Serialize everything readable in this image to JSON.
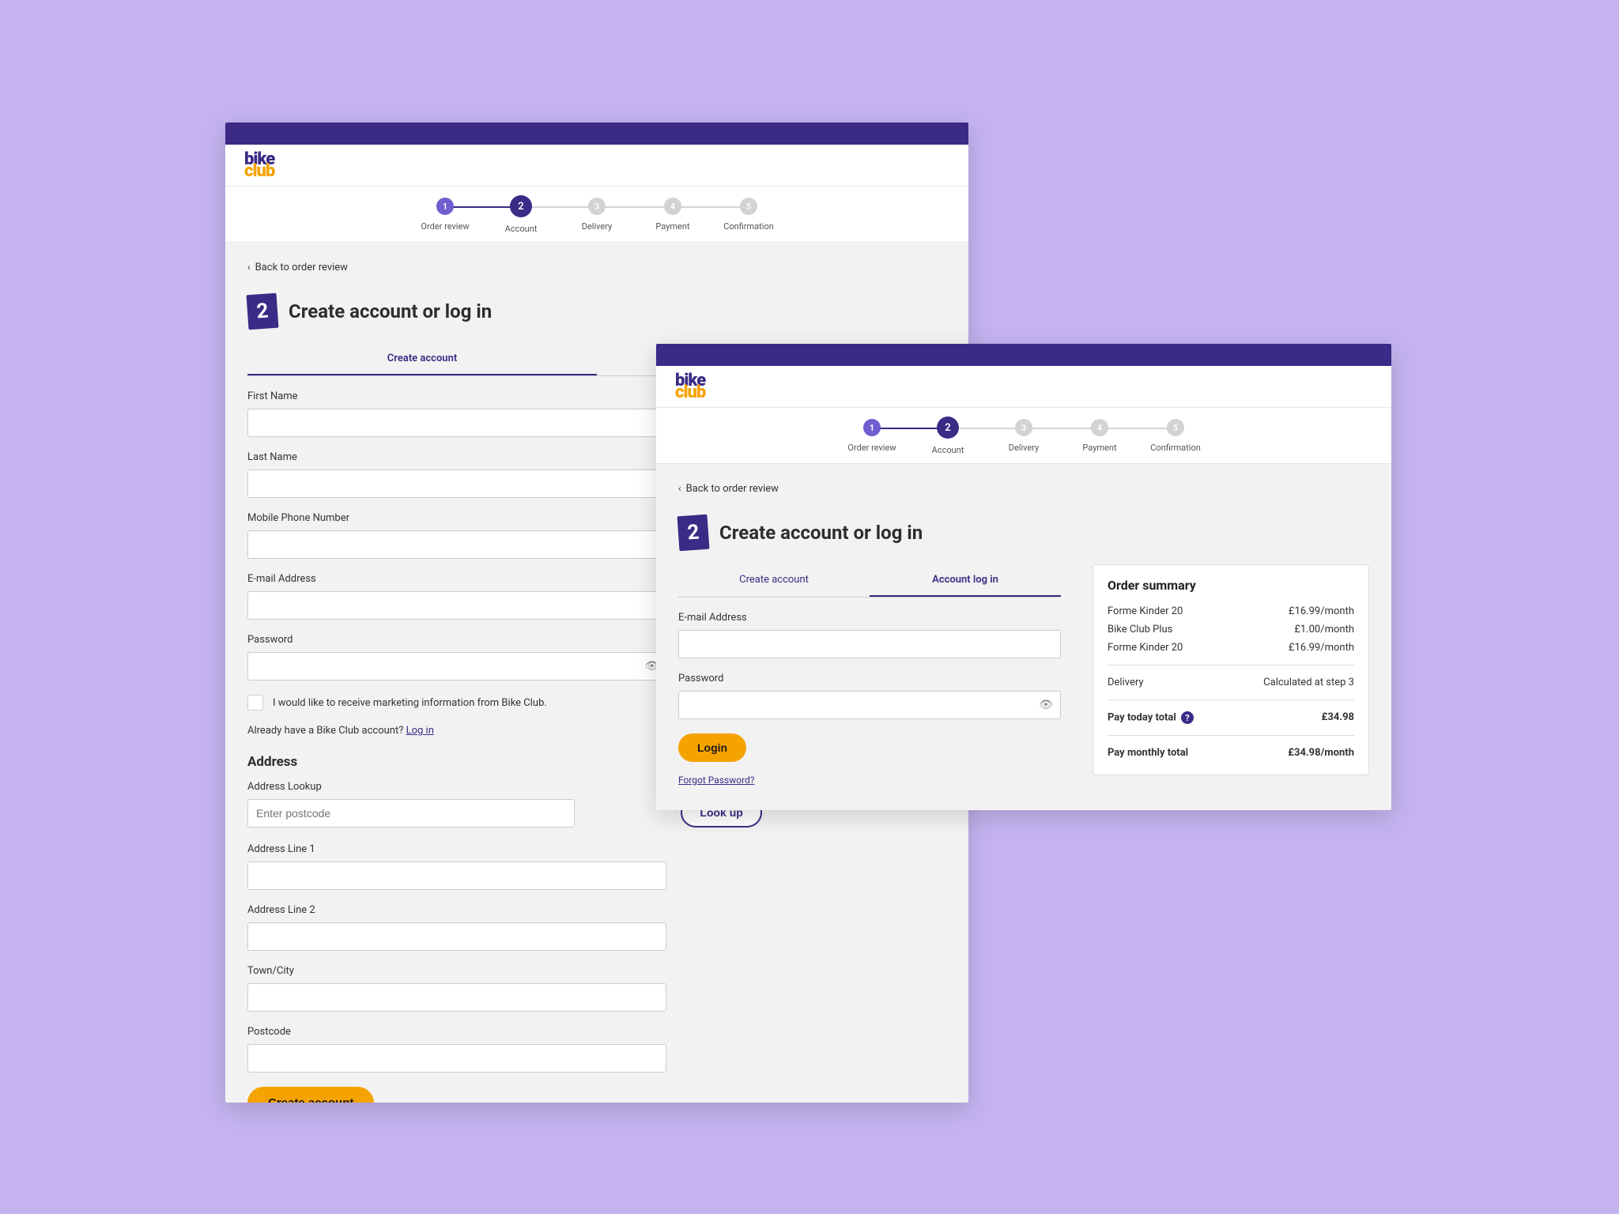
{
  "brand": {
    "line1": "bike",
    "line2": "club"
  },
  "stepper": {
    "steps": [
      {
        "num": "1",
        "label": "Order review"
      },
      {
        "num": "2",
        "label": "Account"
      },
      {
        "num": "3",
        "label": "Delivery"
      },
      {
        "num": "4",
        "label": "Payment"
      },
      {
        "num": "5",
        "label": "Confirmation"
      }
    ]
  },
  "backLink": "Back to order review",
  "stepBadge": "2",
  "pageTitle": "Create account or log in",
  "tabs": {
    "create": "Create account",
    "login": "Account log in"
  },
  "formA": {
    "firstName": "First Name",
    "lastName": "Last Name",
    "mobile": "Mobile Phone Number",
    "email": "E-mail Address",
    "password": "Password",
    "marketing": "I would like to receive marketing information from Bike Club.",
    "alreadyPrompt": "Already have a Bike Club account? ",
    "loginLink": "Log in",
    "addressHeading": "Address",
    "addressLookup": "Address Lookup",
    "postcodePlaceholder": "Enter postcode",
    "lookupBtn": "Look up",
    "addr1": "Address Line 1",
    "addr2": "Address Line 2",
    "town": "Town/City",
    "postcode": "Postcode",
    "submit": "Create account"
  },
  "formB": {
    "email": "E-mail Address",
    "password": "Password",
    "loginBtn": "Login",
    "forgot": "Forgot Password?"
  },
  "summary": {
    "title": "Order summary",
    "line1": {
      "name": "Forme Kinder 20",
      "price": "£16.99/month"
    },
    "line2": {
      "name": "Bike Club Plus",
      "price": "£1.00/month"
    },
    "line3": {
      "name": "Forme Kinder 20",
      "price": "£16.99/month"
    },
    "delivery": {
      "label": "Delivery",
      "value": "Calculated at step 3"
    },
    "payToday": {
      "label": "Pay today total",
      "value": "£34.98"
    },
    "payMonthly": {
      "label": "Pay monthly total",
      "value": "£34.98/month"
    }
  }
}
